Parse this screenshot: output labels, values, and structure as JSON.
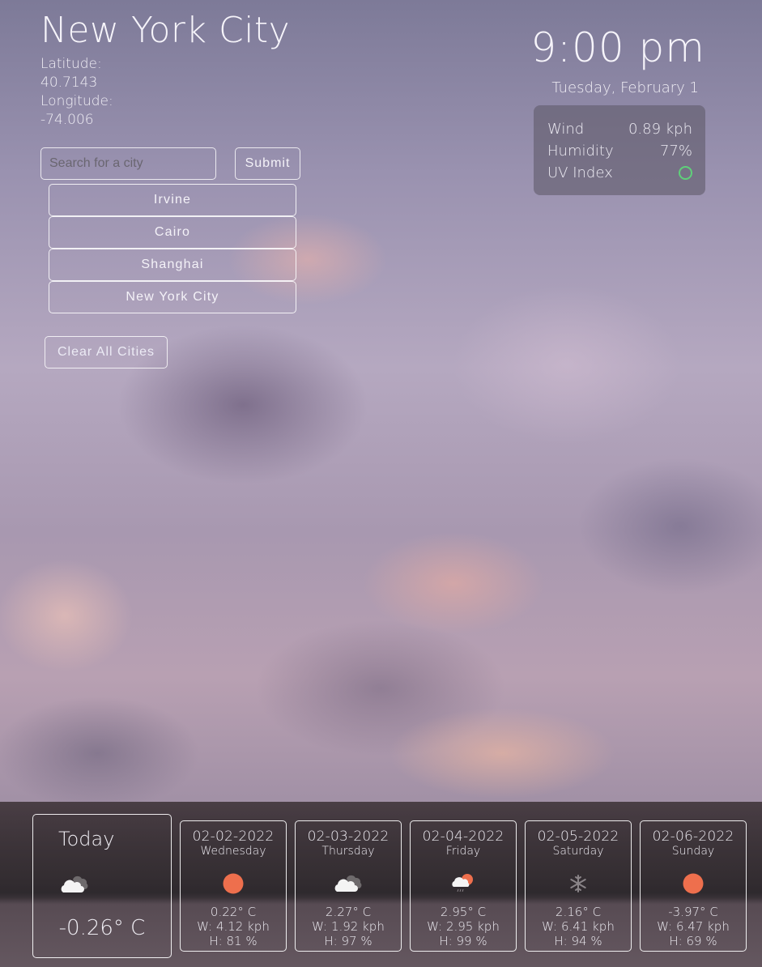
{
  "city": {
    "name": "New York City",
    "latitude_label": "Latitude:",
    "latitude": "40.7143",
    "longitude_label": "Longitude:",
    "longitude": "-74.006"
  },
  "search": {
    "placeholder": "Search for a city",
    "value": "",
    "submit_label": "Submit"
  },
  "history": [
    {
      "label": "Irvine"
    },
    {
      "label": "Cairo"
    },
    {
      "label": "Shanghai"
    },
    {
      "label": "New York City"
    }
  ],
  "clear_label": "Clear All Cities",
  "clock": {
    "time": "9:00 pm",
    "date": "Tuesday, February 1"
  },
  "current": {
    "wind_label": "Wind",
    "wind": "0.89 kph",
    "humidity_label": "Humidity",
    "humidity": "77%",
    "uv_label": "UV Index",
    "uv": "0",
    "uv_color": "#5fd07a"
  },
  "today": {
    "label": "Today",
    "icon": "cloudy-icon",
    "temp": "-0.26° C"
  },
  "forecast": [
    {
      "date": "02-02-2022",
      "day": "Wednesday",
      "icon": "sun-icon",
      "temp": "0.22° C",
      "wind": "W: 4.12 kph",
      "humidity": "H: 81 %"
    },
    {
      "date": "02-03-2022",
      "day": "Thursday",
      "icon": "cloudy-icon",
      "temp": "2.27° C",
      "wind": "W: 1.92 kph",
      "humidity": "H: 97 %"
    },
    {
      "date": "02-04-2022",
      "day": "Friday",
      "icon": "sun-rain-icon",
      "temp": "2.95° C",
      "wind": "W: 2.95 kph",
      "humidity": "H: 99 %"
    },
    {
      "date": "02-05-2022",
      "day": "Saturday",
      "icon": "snowflake-icon",
      "temp": "2.16° C",
      "wind": "W: 6.41 kph",
      "humidity": "H: 94 %"
    },
    {
      "date": "02-06-2022",
      "day": "Sunday",
      "icon": "sun-icon",
      "temp": "-3.97° C",
      "wind": "W: 6.47 kph",
      "humidity": "H: 69 %"
    }
  ],
  "colors": {
    "sun": "#ee6f4d",
    "cloud": "#f4f4f4",
    "cloud_shadow": "#6e6a6c",
    "snow": "#8a8488"
  }
}
